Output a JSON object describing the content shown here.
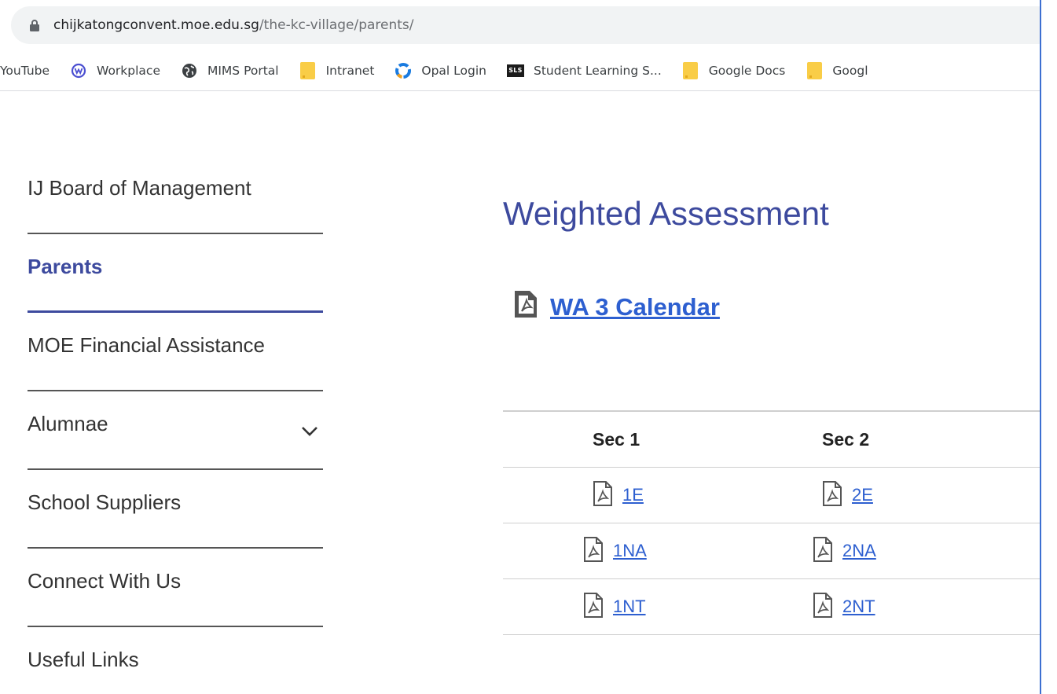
{
  "browser": {
    "url_host": "chijkatongconvent.moe.edu.sg",
    "url_path": "/the-kc-village/parents/",
    "bookmarks": [
      {
        "label": "YouTube",
        "icon": "none"
      },
      {
        "label": "Workplace",
        "icon": "workplace-icon"
      },
      {
        "label": "MIMS Portal",
        "icon": "globe-icon"
      },
      {
        "label": "Intranet",
        "icon": "folder-icon"
      },
      {
        "label": "Opal Login",
        "icon": "opal-icon"
      },
      {
        "label": "Student Learning S...",
        "icon": "sls-icon"
      },
      {
        "label": "Google Docs",
        "icon": "folder-icon"
      },
      {
        "label": "Googl",
        "icon": "folder-icon"
      }
    ],
    "sls_text": "SLS"
  },
  "sidebar": {
    "items": [
      {
        "label": "IJ Board of Management"
      },
      {
        "label": "Parents",
        "active": true
      },
      {
        "label": "MOE Financial Assistance"
      },
      {
        "label": "Alumnae",
        "expandable": true
      },
      {
        "label": "School Suppliers"
      },
      {
        "label": "Connect With Us"
      },
      {
        "label": "Useful Links"
      }
    ]
  },
  "main": {
    "title": "Weighted Assessment",
    "calendar_link": "WA 3 Calendar",
    "table": {
      "headers": [
        "Sec 1",
        "Sec 2"
      ],
      "rows": [
        [
          "1E",
          "2E"
        ],
        [
          "1NA",
          "2NA"
        ],
        [
          "1NT",
          "2NT"
        ]
      ]
    }
  },
  "colors": {
    "accent": "#3d4a9e",
    "link": "#2d5fd0",
    "frame_border": "#3d6fd1"
  }
}
